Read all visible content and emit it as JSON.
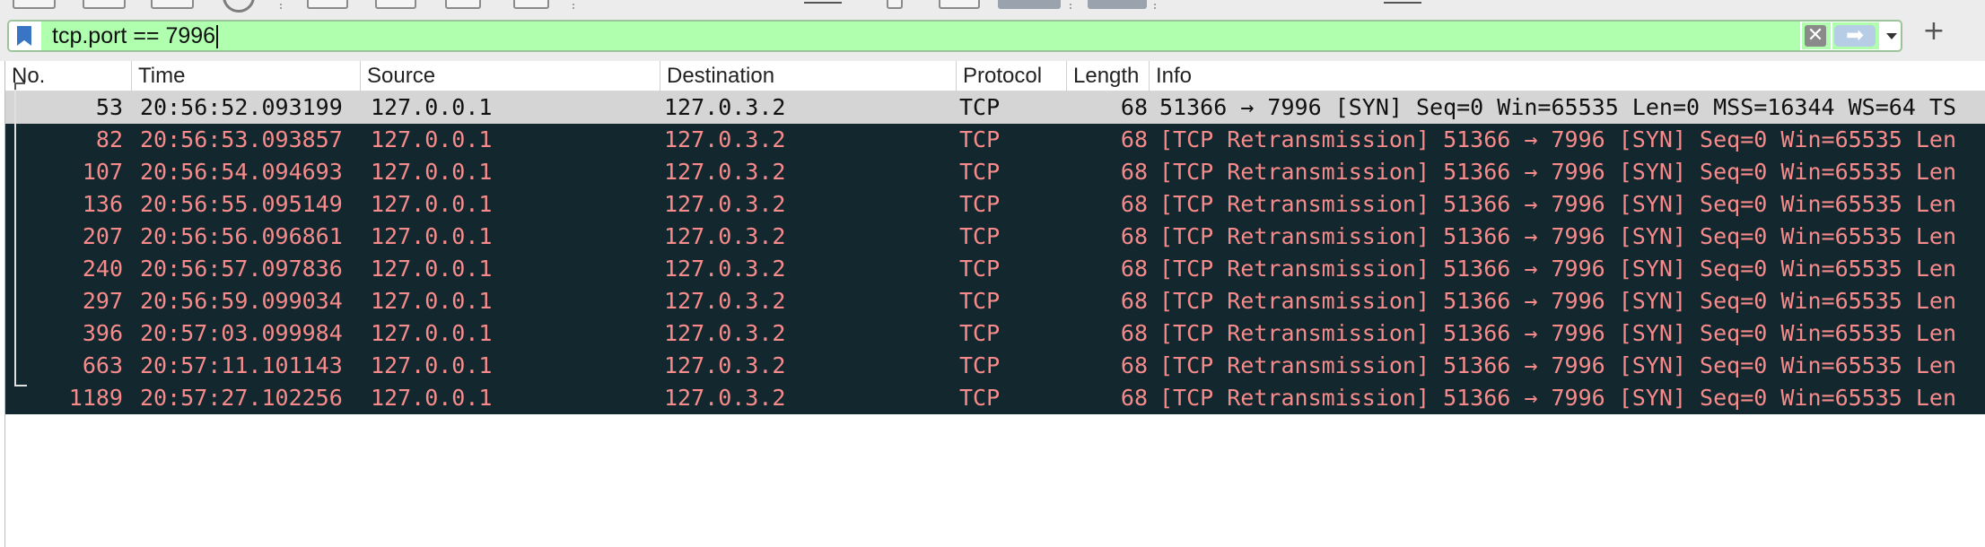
{
  "filter": {
    "value": "tcp.port == 7996",
    "bookmark_icon": "bookmark-icon",
    "clear_icon": "clear-x-icon",
    "clear_glyph": "✕",
    "apply_icon": "arrow-right-icon",
    "apply_glyph": "➡",
    "dropdown_icon": "chevron-down-icon",
    "add_icon": "plus-icon",
    "add_glyph": "+",
    "background_color": "#afffaf"
  },
  "columns": [
    "No.",
    "Time",
    "Source",
    "Destination",
    "Protocol",
    "Length",
    "Info"
  ],
  "colors": {
    "retransmission_bg": "#12272e",
    "retransmission_fg": "#f78b8b",
    "selected_bg": "#d5d5d5"
  },
  "packets": [
    {
      "no": "53",
      "time": "20:56:52.093199",
      "source": "127.0.0.1",
      "destination": "127.0.3.2",
      "protocol": "TCP",
      "length": "68",
      "info": "51366 → 7996 [SYN] Seq=0 Win=65535 Len=0 MSS=16344 WS=64 TS"
    },
    {
      "no": "82",
      "time": "20:56:53.093857",
      "source": "127.0.0.1",
      "destination": "127.0.3.2",
      "protocol": "TCP",
      "length": "68",
      "info": "[TCP Retransmission] 51366 → 7996 [SYN] Seq=0 Win=65535 Len"
    },
    {
      "no": "107",
      "time": "20:56:54.094693",
      "source": "127.0.0.1",
      "destination": "127.0.3.2",
      "protocol": "TCP",
      "length": "68",
      "info": "[TCP Retransmission] 51366 → 7996 [SYN] Seq=0 Win=65535 Len"
    },
    {
      "no": "136",
      "time": "20:56:55.095149",
      "source": "127.0.0.1",
      "destination": "127.0.3.2",
      "protocol": "TCP",
      "length": "68",
      "info": "[TCP Retransmission] 51366 → 7996 [SYN] Seq=0 Win=65535 Len"
    },
    {
      "no": "207",
      "time": "20:56:56.096861",
      "source": "127.0.0.1",
      "destination": "127.0.3.2",
      "protocol": "TCP",
      "length": "68",
      "info": "[TCP Retransmission] 51366 → 7996 [SYN] Seq=0 Win=65535 Len"
    },
    {
      "no": "240",
      "time": "20:56:57.097836",
      "source": "127.0.0.1",
      "destination": "127.0.3.2",
      "protocol": "TCP",
      "length": "68",
      "info": "[TCP Retransmission] 51366 → 7996 [SYN] Seq=0 Win=65535 Len"
    },
    {
      "no": "297",
      "time": "20:56:59.099034",
      "source": "127.0.0.1",
      "destination": "127.0.3.2",
      "protocol": "TCP",
      "length": "68",
      "info": "[TCP Retransmission] 51366 → 7996 [SYN] Seq=0 Win=65535 Len"
    },
    {
      "no": "396",
      "time": "20:57:03.099984",
      "source": "127.0.0.1",
      "destination": "127.0.3.2",
      "protocol": "TCP",
      "length": "68",
      "info": "[TCP Retransmission] 51366 → 7996 [SYN] Seq=0 Win=65535 Len"
    },
    {
      "no": "663",
      "time": "20:57:11.101143",
      "source": "127.0.0.1",
      "destination": "127.0.3.2",
      "protocol": "TCP",
      "length": "68",
      "info": "[TCP Retransmission] 51366 → 7996 [SYN] Seq=0 Win=65535 Len"
    },
    {
      "no": "1189",
      "time": "20:57:27.102256",
      "source": "127.0.0.1",
      "destination": "127.0.3.2",
      "protocol": "TCP",
      "length": "68",
      "info": "[TCP Retransmission] 51366 → 7996 [SYN] Seq=0 Win=65535 Len"
    }
  ]
}
